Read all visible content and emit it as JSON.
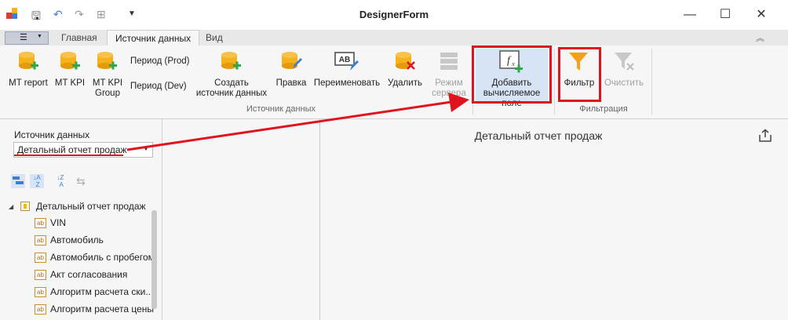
{
  "window": {
    "title": "DesignerForm",
    "controls": {
      "minimize": "—",
      "maximize": "☐",
      "close": "✕"
    }
  },
  "ribbon_tabs": [
    {
      "label": "Главная"
    },
    {
      "label": "Источник данных"
    },
    {
      "label": "Вид"
    }
  ],
  "ribbon": {
    "mt_report": "MT report",
    "mt_kpi": "MT KPI",
    "mt_kpi_group_1": "MT KPI",
    "mt_kpi_group_2": "Group",
    "period_prod": "Период (Prod)",
    "period_dev": "Период (Dev)",
    "create_1": "Создать",
    "create_2": "источник данных",
    "edit": "Правка",
    "rename": "Переименовать",
    "delete": "Удалить",
    "server_mode_1": "Режим",
    "server_mode_2": "сервера",
    "add_calc_1": "Добавить",
    "add_calc_2": "вычисляемое поле",
    "filter": "Фильтр",
    "clear": "Очистить",
    "group_datasource": "Источник данных",
    "group_filter": "Фильтрация"
  },
  "left_panel": {
    "datasource_label": "Источник данных",
    "datasource_value": "Детальный отчет продаж",
    "tree_root": "Детальный отчет продаж",
    "tree_items": [
      "VIN",
      "Автомобиль",
      "Автомобиль с пробегом",
      "Акт согласования",
      "Алгоритм расчета ски...",
      "Алгоритм расчета цены"
    ]
  },
  "main": {
    "report_title": "Детальный отчет продаж"
  },
  "colors": {
    "highlight": "#e0141f",
    "yellow": "#f5b21b",
    "green": "#2ea84b",
    "blue": "#3a7fd5"
  }
}
